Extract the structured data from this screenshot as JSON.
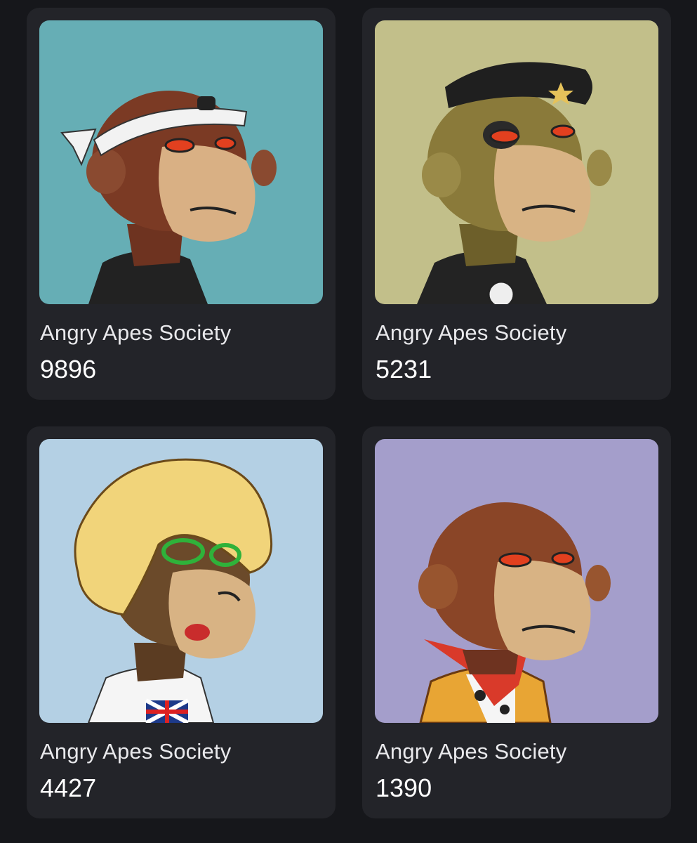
{
  "gallery": {
    "cards": [
      {
        "collection": "Angry Apes Society",
        "token_id": "9896",
        "background_color": "#66aeb5",
        "fur_color": "#7b3a24",
        "accessory": "white headband with sushi pin"
      },
      {
        "collection": "Angry Apes Society",
        "token_id": "5231",
        "background_color": "#c2bf8a",
        "fur_color": "#8a7a3a",
        "accessory": "black beret with gold star"
      },
      {
        "collection": "Angry Apes Society",
        "token_id": "4427",
        "background_color": "#b4d0e4",
        "fur_color": "#6b4a2a",
        "accessory": "blonde wig and green glasses"
      },
      {
        "collection": "Angry Apes Society",
        "token_id": "1390",
        "background_color": "#a49ecb",
        "fur_color": "#8a4527",
        "accessory": "red bandana and cowboy vest"
      }
    ]
  }
}
